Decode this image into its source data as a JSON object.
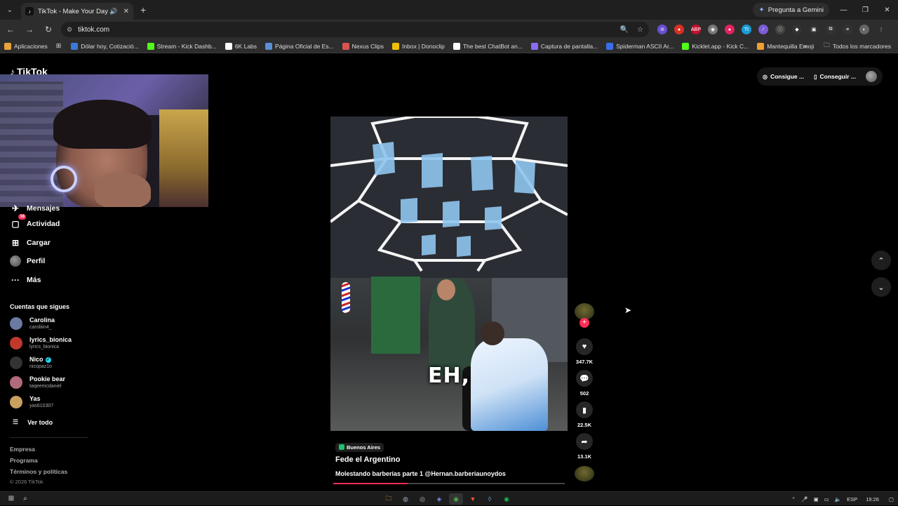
{
  "browser": {
    "tab": {
      "title": "TikTok - Make Your Day"
    },
    "gemini_label": "Pregunta a Gemini",
    "url": "tiktok.com",
    "bookmarks": [
      {
        "label": "Aplicaciones",
        "color": "#e8a33d"
      },
      {
        "label": "Dólar hoy, Cotizació...",
        "color": "#3a7bd5"
      },
      {
        "label": "Stream - Kick Dashb...",
        "color": "#53fc18"
      },
      {
        "label": "6K Labs",
        "color": "#ffffff"
      },
      {
        "label": "Página Oficial de Es...",
        "color": "#5b8fd6"
      },
      {
        "label": "Nexus Clips",
        "color": "#d9534f"
      },
      {
        "label": "Inbox | Donoclip",
        "color": "#f0c000"
      },
      {
        "label": "The best ChatBot an...",
        "color": "#ffffff"
      },
      {
        "label": "Captura de pantalla...",
        "color": "#8a6cf0"
      },
      {
        "label": "Spiderman ASCII Ar...",
        "color": "#3a6ee8"
      },
      {
        "label": "Kicklet.app - Kick C...",
        "color": "#53fc18"
      },
      {
        "label": "Mantequilla Emoji",
        "color": "#f0a030"
      }
    ],
    "all_bookmarks": "Todos los marcadores"
  },
  "tiktok": {
    "logo": "TikTok",
    "nav": [
      {
        "label": "Mensajes",
        "icon": "send-icon"
      },
      {
        "label": "Actividad",
        "icon": "inbox-icon",
        "badge": "16"
      },
      {
        "label": "Cargar",
        "icon": "upload-icon"
      },
      {
        "label": "Perfil",
        "icon": "profile-avatar"
      },
      {
        "label": "Más",
        "icon": "more-icon"
      }
    ],
    "following_title": "Cuentas que sigues",
    "following": [
      {
        "name": "Carolina",
        "handle": "caroliiin4_",
        "color": "#6a7aa0"
      },
      {
        "name": "lyrics_bionica",
        "handle": "lyrics_bionica",
        "color": "#c0392b"
      },
      {
        "name": "Nico",
        "handle": "nicopaz1o",
        "verified": true,
        "color": "#333"
      },
      {
        "name": "Pookie bear",
        "handle": "taqeemcdaniel",
        "color": "#b06a7a"
      },
      {
        "name": "Yas",
        "handle": "yas610307",
        "color": "#c9a060"
      }
    ],
    "see_all": "Ver todo",
    "footer": [
      "Empresa",
      "Programa",
      "Términos y políticas"
    ],
    "copyright": "© 2026 TikTok",
    "top_right": {
      "coins": "Consigue ...",
      "app": "Conseguir ..."
    },
    "video": {
      "caption_overlay": "EH,",
      "location": "Buenos Aires",
      "author": "Fede el Argentino",
      "description": "Molestando barberías parte 1 @Hernan.barberiaunoydos",
      "progress": 0.32,
      "stats": {
        "likes": "347.7K",
        "comments": "502",
        "saves": "22.5K",
        "shares": "13.1K"
      }
    }
  },
  "taskbar": {
    "lang": "ESP",
    "time": "19:26"
  }
}
